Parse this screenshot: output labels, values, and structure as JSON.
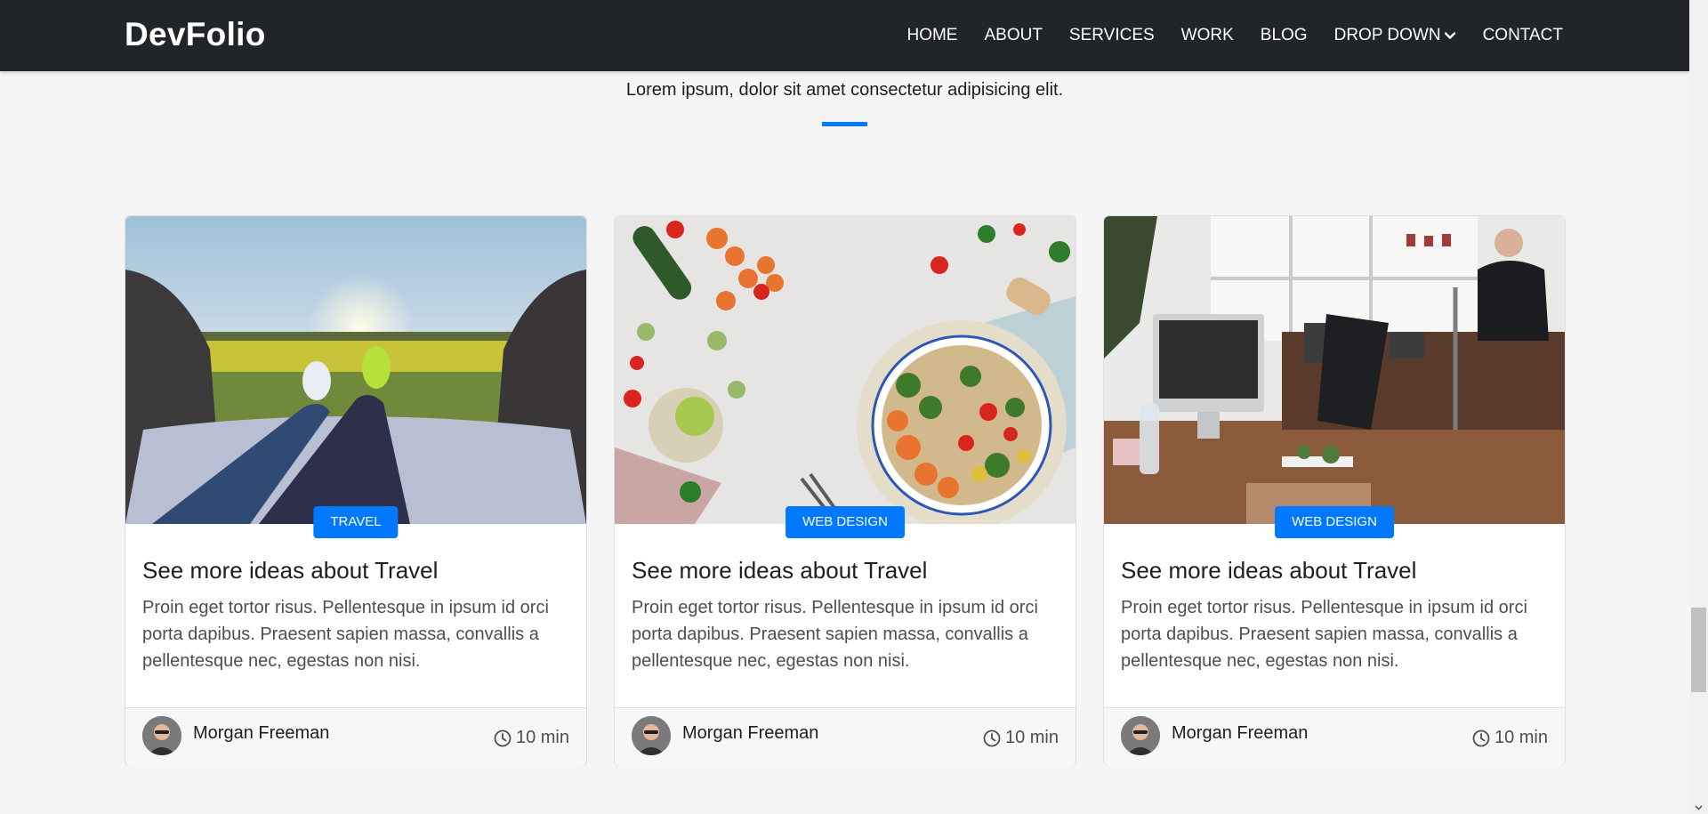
{
  "navbar": {
    "brand": "DevFolio",
    "items": [
      {
        "label": "HOME"
      },
      {
        "label": "ABOUT"
      },
      {
        "label": "SERVICES"
      },
      {
        "label": "WORK"
      },
      {
        "label": "BLOG"
      },
      {
        "label": "DROP DOWN",
        "icon": "chevron-down-icon"
      },
      {
        "label": "CONTACT"
      }
    ]
  },
  "section": {
    "subtitle": "Lorem ipsum, dolor sit amet consectetur adipisicing elit.",
    "accent_color": "#0078ff"
  },
  "cards": [
    {
      "category": "TRAVEL",
      "title": "See more ideas about Travel",
      "description": "Proin eget tortor risus. Pellentesque in ipsum id orci porta dapibus. Praesent sapien massa, convallis a pellentesque nec, egestas non nisi.",
      "author": "Morgan Freeman",
      "read_time": "10 min",
      "image": "travel-photo"
    },
    {
      "category": "WEB DESIGN",
      "title": "See more ideas about Travel",
      "description": "Proin eget tortor risus. Pellentesque in ipsum id orci porta dapibus. Praesent sapien massa, convallis a pellentesque nec, egestas non nisi.",
      "author": "Morgan Freeman",
      "read_time": "10 min",
      "image": "food-photo"
    },
    {
      "category": "WEB DESIGN",
      "title": "See more ideas about Travel",
      "description": "Proin eget tortor risus. Pellentesque in ipsum id orci porta dapibus. Praesent sapien massa, convallis a pellentesque nec, egestas non nisi.",
      "author": "Morgan Freeman",
      "read_time": "10 min",
      "image": "office-photo"
    }
  ]
}
